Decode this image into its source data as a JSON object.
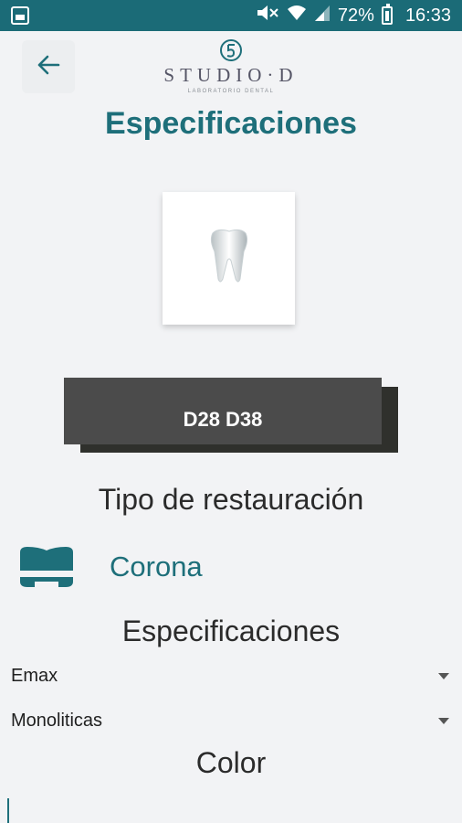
{
  "status_bar": {
    "battery": "72%",
    "time": "16:33",
    "icons": [
      "screenshot-icon",
      "mute-icon",
      "wifi-icon",
      "signal-icon",
      "battery-icon"
    ]
  },
  "header": {
    "back_icon": "arrow-left-icon",
    "logo_name": "STUDIO·D",
    "logo_sub": "LABORATORIO DENTAL",
    "title": "Especificaciones"
  },
  "tooth": {
    "selected": "D28 D38"
  },
  "restoration": {
    "section_title": "Tipo de restauración",
    "type_label": "Corona",
    "icon": "crown-icon"
  },
  "specs": {
    "section_title": "Especificaciones",
    "material": "Emax",
    "technique": "Monoliticas"
  },
  "color": {
    "section_title": "Color"
  },
  "colors": {
    "accent": "#1e6f7a",
    "status_bar": "#1b6b77",
    "block": "#4b4b4b"
  }
}
